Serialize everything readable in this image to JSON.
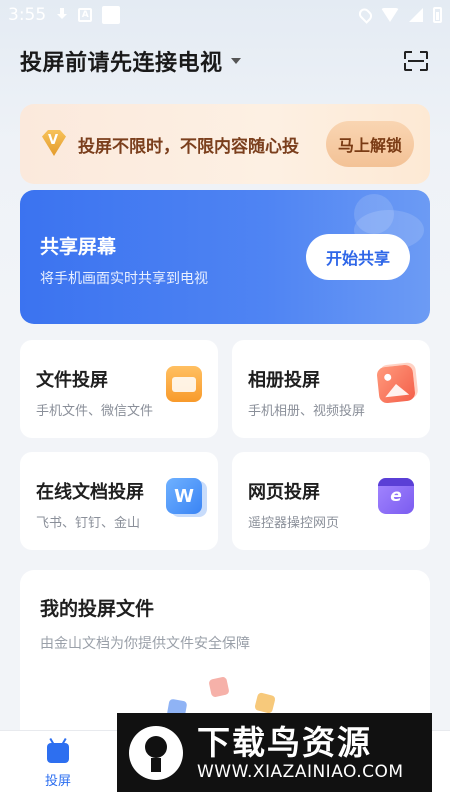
{
  "status_bar": {
    "time": "3:55"
  },
  "header": {
    "title": "投屏前请先连接电视"
  },
  "vip_banner": {
    "text": "投屏不限时，不限内容随心投",
    "unlock_label": "马上解锁"
  },
  "share_screen": {
    "title": "共享屏幕",
    "subtitle": "将手机画面实时共享到电视",
    "button_label": "开始共享"
  },
  "features": [
    {
      "title": "文件投屏",
      "subtitle": "手机文件、微信文件",
      "icon": "folder-icon"
    },
    {
      "title": "相册投屏",
      "subtitle": "手机相册、视频投屏",
      "icon": "photo-album-icon"
    },
    {
      "title": "在线文档投屏",
      "subtitle": "飞书、钉钉、金山",
      "icon": "document-icon",
      "glyph": "W"
    },
    {
      "title": "网页投屏",
      "subtitle": "遥控器操控网页",
      "icon": "browser-icon",
      "glyph": "e"
    }
  ],
  "my_files": {
    "title": "我的投屏文件",
    "subtitle": "由金山文档为你提供文件安全保障"
  },
  "tab_bar": {
    "items": [
      {
        "label": "投屏",
        "icon": "tv-icon",
        "active": true
      }
    ]
  },
  "watermark": {
    "text": "下载鸟资源",
    "url": "WWW.XIAZAINIAO.COM"
  },
  "colors": {
    "accent": "#2d6ff0",
    "vip_text": "#7b3f1d",
    "share_card": "#3b73f0"
  }
}
